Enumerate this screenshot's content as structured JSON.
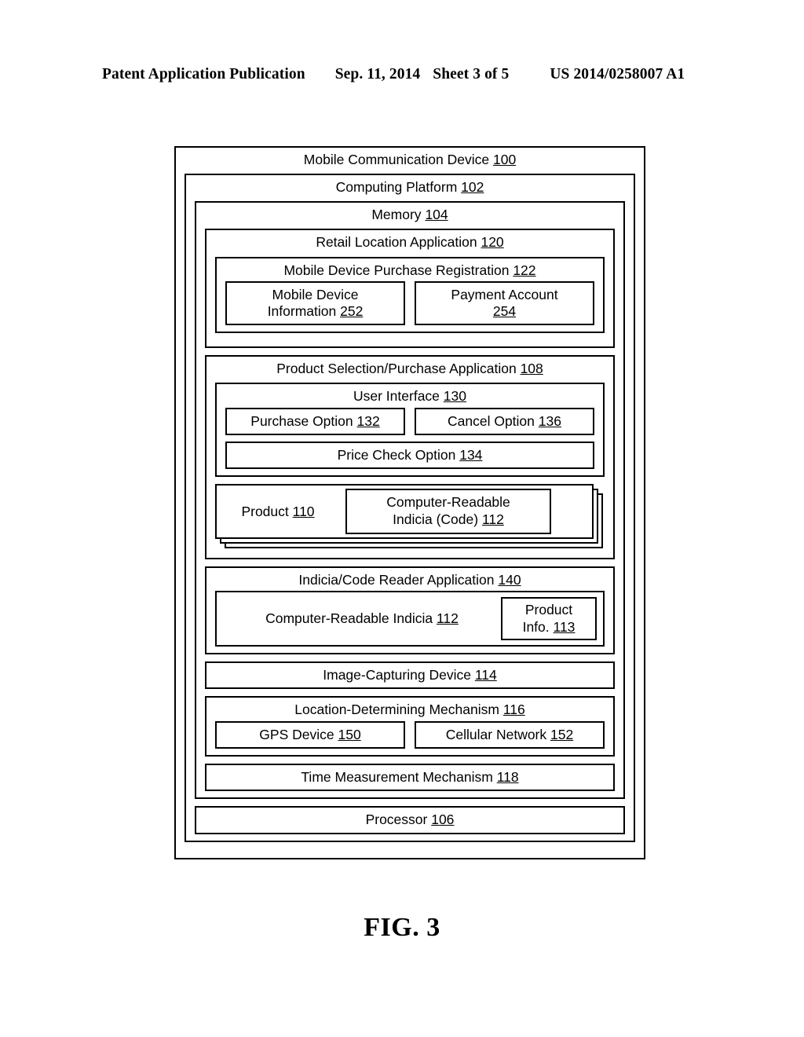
{
  "header": {
    "publication": "Patent Application Publication",
    "date": "Sep. 11, 2014",
    "sheet": "Sheet 3 of 5",
    "patent_number": "US 2014/0258007 A1"
  },
  "figure": {
    "caption": "FIG. 3",
    "device": {
      "label": "Mobile Communication Device",
      "ref": "100"
    },
    "platform": {
      "label": "Computing Platform",
      "ref": "102"
    },
    "memory": {
      "label": "Memory",
      "ref": "104"
    },
    "retail_location_application": {
      "label": "Retail Location Application",
      "ref": "120",
      "purchase_registration": {
        "label": "Mobile Device Purchase Registration",
        "ref": "122",
        "items": [
          {
            "line1": "Mobile Device",
            "line2": "Information",
            "ref": "252"
          },
          {
            "line1": "Payment Account",
            "line2": "",
            "ref": "254"
          }
        ]
      }
    },
    "product_selection_application": {
      "label": "Product Selection/Purchase Application",
      "ref": "108",
      "user_interface": {
        "label": "User Interface",
        "ref": "130",
        "options": [
          {
            "label": "Purchase Option",
            "ref": "132"
          },
          {
            "label": "Cancel Option",
            "ref": "136"
          },
          {
            "label": "Price Check Option",
            "ref": "134"
          }
        ]
      },
      "product": {
        "label": "Product",
        "ref": "110",
        "code": {
          "line1": "Computer-Readable",
          "line2": "Indicia (Code)",
          "ref": "112"
        }
      }
    },
    "indicia_reader_application": {
      "label": "Indicia/Code Reader Application",
      "ref": "140",
      "indicia": {
        "label": "Computer-Readable Indicia",
        "ref": "112"
      },
      "product_info": {
        "line1": "Product",
        "line2": "Info.",
        "ref": "113"
      }
    },
    "image_capturing_device": {
      "label": "Image-Capturing Device",
      "ref": "114"
    },
    "location_mechanism": {
      "label": "Location-Determining Mechanism",
      "ref": "116",
      "items": [
        {
          "label": "GPS Device",
          "ref": "150"
        },
        {
          "label": "Cellular Network",
          "ref": "152"
        }
      ]
    },
    "time_mechanism": {
      "label": "Time Measurement Mechanism",
      "ref": "118"
    },
    "processor": {
      "label": "Processor",
      "ref": "106"
    }
  }
}
